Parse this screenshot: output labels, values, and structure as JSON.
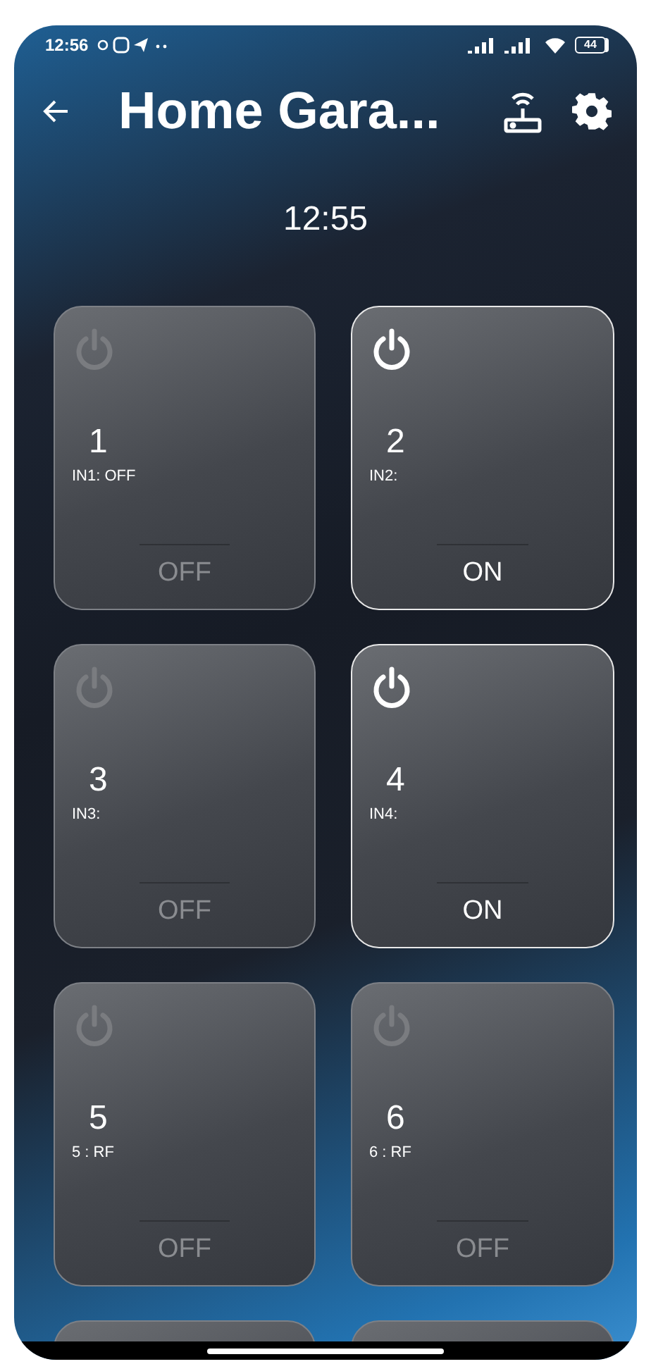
{
  "status_bar": {
    "time": "12:56",
    "battery": "44"
  },
  "header": {
    "title": "Home Gara..."
  },
  "clock": "12:55",
  "channels": [
    {
      "number": "1",
      "input": "IN1: OFF",
      "on": false,
      "state": "OFF"
    },
    {
      "number": "2",
      "input": "IN2:",
      "on": true,
      "state": "ON"
    },
    {
      "number": "3",
      "input": "IN3:",
      "on": false,
      "state": "OFF"
    },
    {
      "number": "4",
      "input": "IN4:",
      "on": true,
      "state": "ON"
    },
    {
      "number": "5",
      "input": "5 : RF",
      "on": false,
      "state": "OFF"
    },
    {
      "number": "6",
      "input": "6 : RF",
      "on": false,
      "state": "OFF"
    },
    {
      "on": false
    },
    {
      "on": false
    }
  ]
}
